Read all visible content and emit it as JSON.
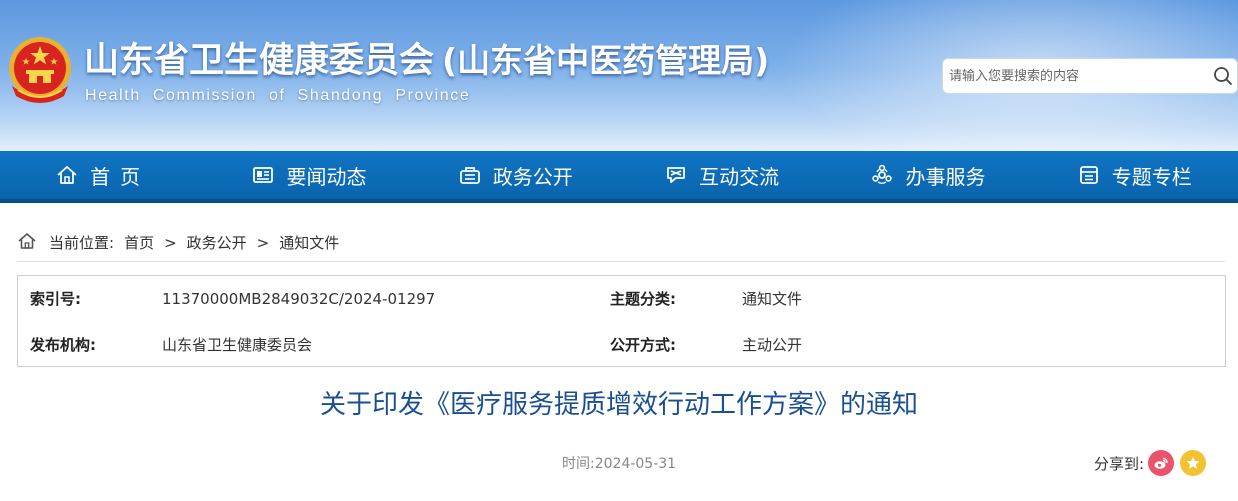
{
  "header": {
    "title": "山东省卫生健康委员会",
    "subtitle": "(山东省中医药管理局)",
    "english_name": "Health Commission of Shandong Province",
    "emblem_icon": "national-emblem-icon",
    "search": {
      "placeholder": "请输入您要搜索的内容",
      "value": "",
      "icon": "search-icon"
    }
  },
  "nav": {
    "items": [
      {
        "label": "首页",
        "icon": "home-icon"
      },
      {
        "label": "要闻动态",
        "icon": "news-icon"
      },
      {
        "label": "政务公开",
        "icon": "government-affairs-icon"
      },
      {
        "label": "互动交流",
        "icon": "interaction-icon"
      },
      {
        "label": "办事服务",
        "icon": "service-icon"
      },
      {
        "label": "专题专栏",
        "icon": "topic-icon"
      }
    ]
  },
  "breadcrumb": {
    "prefix": "当前位置:",
    "items": [
      "首页",
      "政务公开",
      "通知文件"
    ],
    "separator": ">"
  },
  "meta": {
    "index_label": "索引号:",
    "index_value": "11370000MB2849032C/2024-01297",
    "category_label": "主题分类:",
    "category_value": "通知文件",
    "publisher_label": "发布机构:",
    "publisher_value": "山东省卫生健康委员会",
    "disclosure_label": "公开方式:",
    "disclosure_value": "主动公开"
  },
  "article": {
    "title": "关于印发《医疗服务提质增效行动工作方案》的通知",
    "time": "时间:2024-05-31"
  },
  "share": {
    "label": "分享到:",
    "buttons": [
      "weibo-icon",
      "favorite-icon"
    ]
  },
  "colors": {
    "nav_bg": "#0a64ad",
    "title_blue": "#1a4f93",
    "weibo_red": "#e9546b",
    "favorite_yellow": "#f2c230"
  }
}
